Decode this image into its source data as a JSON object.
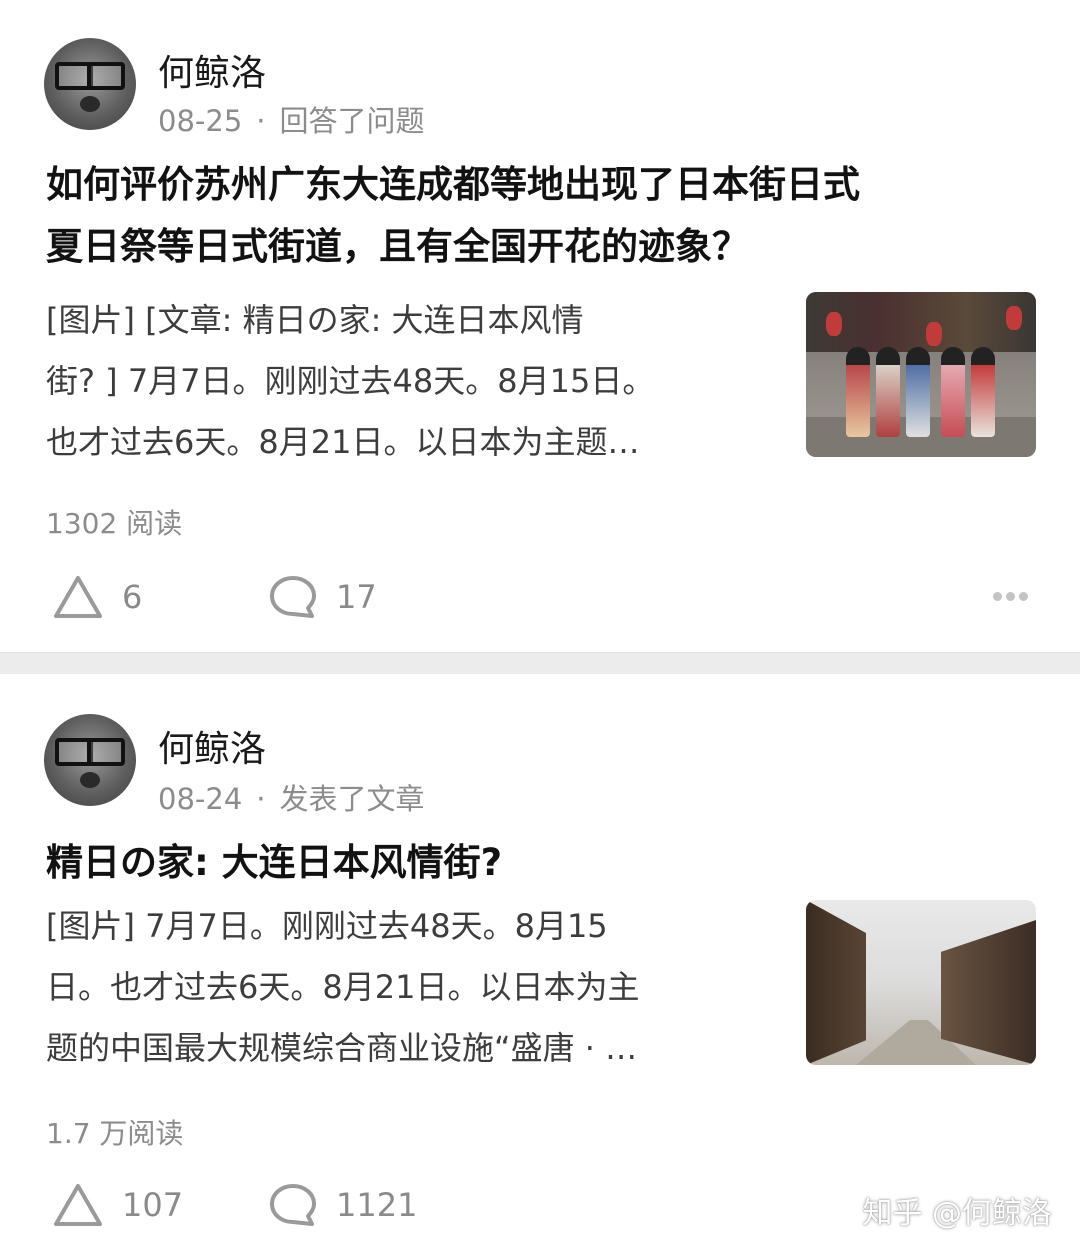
{
  "posts": [
    {
      "author": "何鲸洛",
      "date": "08-25",
      "separator": "·",
      "action": "回答了问题",
      "title_lines": [
        "如何评价苏州广东大连成都等地出现了日本街日式",
        "夏日祭等日式街道，且有全国开花的迹象？"
      ],
      "excerpt_lines": [
        "[图片] [文章: 精日の家: 大连日本风情",
        "街? ] 7月7日。刚刚过去48天。8月15日。",
        "也才过去6天。8月21日。以日本为主题…"
      ],
      "reads": "1302 阅读",
      "upvotes": "6",
      "comments": "17"
    },
    {
      "author": "何鲸洛",
      "date": "08-24",
      "separator": "·",
      "action": "发表了文章",
      "title_lines": [
        "精日の家: 大连日本风情街?"
      ],
      "excerpt_lines": [
        "[图片] 7月7日。刚刚过去48天。8月15",
        "日。也才过去6天。8月21日。以日本为主",
        "题的中国最大规模综合商业设施“盛唐 · …"
      ],
      "reads": "1.7 万阅读",
      "upvotes": "107",
      "comments": "1121"
    }
  ],
  "watermark": "知乎 @何鲸洛"
}
